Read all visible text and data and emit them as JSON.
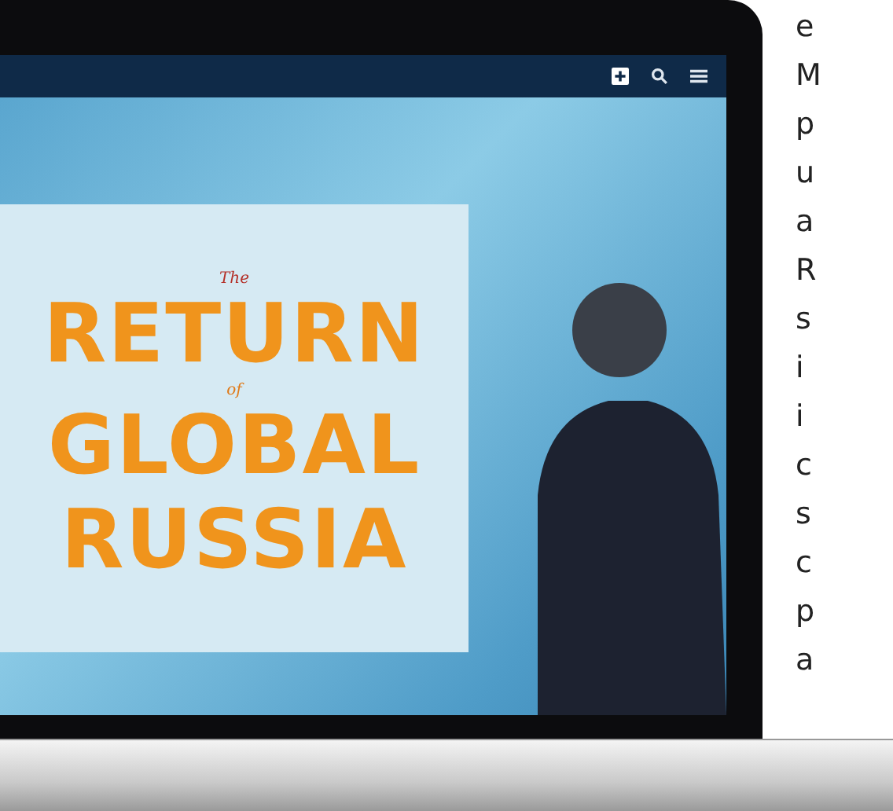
{
  "nav": {
    "icons": [
      {
        "kind": "plus"
      },
      {
        "kind": "search"
      },
      {
        "kind": "menu"
      }
    ]
  },
  "hero": {
    "pretitle": "The",
    "title_line_1": "RETURN",
    "connector": "of",
    "title_line_2": "GLOBAL",
    "title_line_3": "RUSSIA"
  },
  "side_text": [
    "e",
    "M",
    "p",
    "u",
    "a",
    "R",
    "s",
    "i",
    "i",
    "c",
    "s",
    "c",
    "p",
    "a"
  ]
}
